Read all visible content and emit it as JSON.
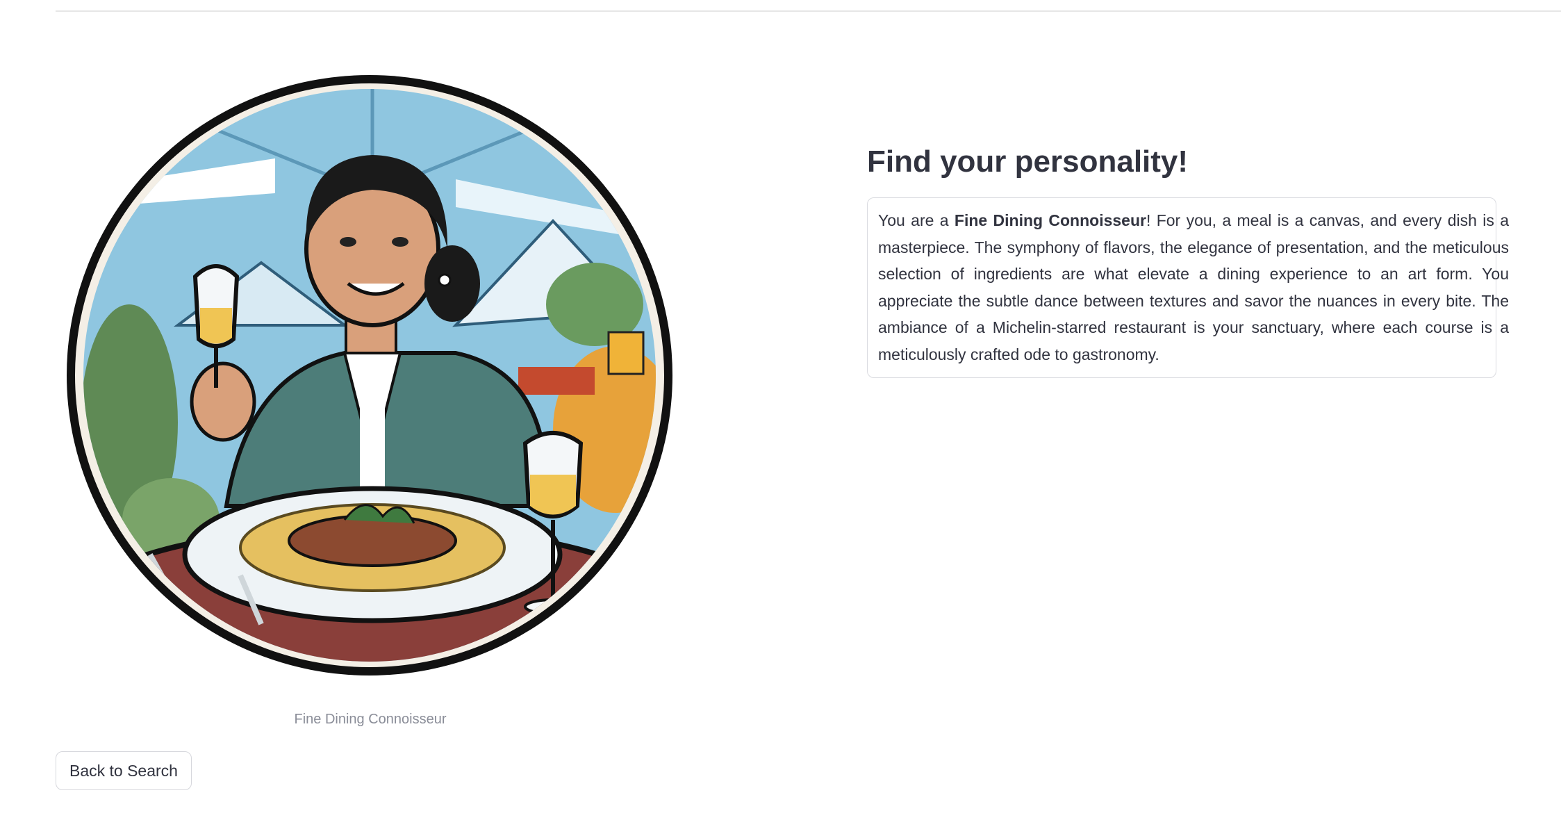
{
  "result": {
    "image_alt": "Fine Dining Connoisseur",
    "caption": "Fine Dining Connoisseur"
  },
  "actions": {
    "back_label": "Back to Search"
  },
  "panel": {
    "heading": "Find your personality!",
    "description_prefix": "You are a ",
    "personality": "Fine Dining Connoisseur",
    "description_suffix": "! For you, a meal is a canvas, and every dish is a masterpiece. The symphony of flavors, the elegance of presentation, and the meticulous selection of ingredients are what elevate a dining experience to an art form. You appreciate the subtle dance between textures and savor the nuances in every bite. The ambiance of a Michelin-starred restaurant is your sanctuary, where each course is a meticulously crafted ode to gastronomy."
  },
  "colors": {
    "text": "#31333f",
    "caption": "#8a8d98",
    "border": "#dadbe0",
    "sky": "#8fc6e0",
    "jacket": "#4d7d79",
    "table": "#8a3f3a"
  }
}
